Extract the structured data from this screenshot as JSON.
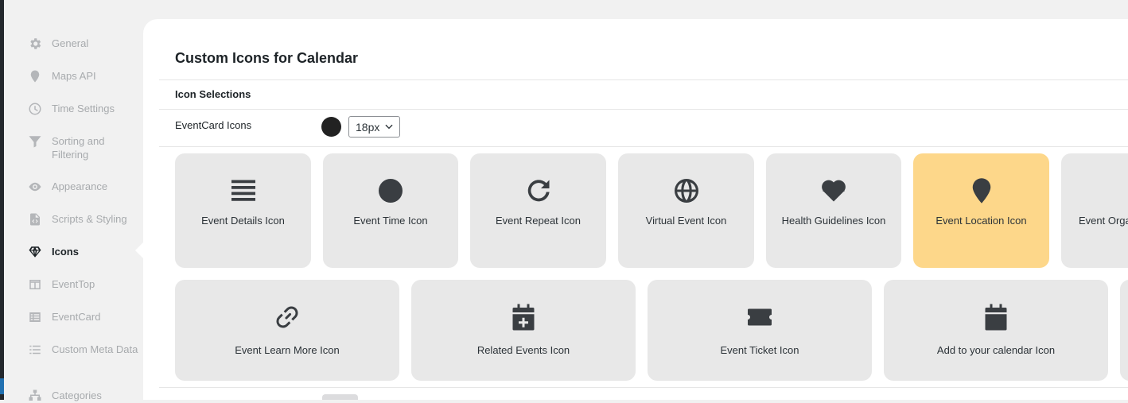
{
  "sidebar": {
    "items": [
      {
        "label": "General",
        "icon": "gear-icon"
      },
      {
        "label": "Maps API",
        "icon": "map-pin-icon"
      },
      {
        "label": "Time Settings",
        "icon": "clock-icon"
      },
      {
        "label": "Sorting and Filtering",
        "icon": "filter-icon"
      },
      {
        "label": "Appearance",
        "icon": "eye-icon"
      },
      {
        "label": "Scripts & Styling",
        "icon": "code-file-icon"
      },
      {
        "label": "Icons",
        "icon": "gem-icon",
        "active": true
      },
      {
        "label": "EventTop",
        "icon": "layout-icon"
      },
      {
        "label": "EventCard",
        "icon": "card-list-icon"
      },
      {
        "label": "Custom Meta Data",
        "icon": "list-icon"
      },
      {
        "label": "Categories",
        "icon": "hierarchy-icon"
      }
    ]
  },
  "panel": {
    "title": "Custom Icons for Calendar",
    "section": "Icon Selections",
    "setting_label": "EventCard Icons",
    "color_value": "#222222",
    "size_value": "18px"
  },
  "colors": {
    "card_bg": "#e8e8e8",
    "card_selected_bg": "#fdd78a",
    "icon_fill": "#3a3e42"
  },
  "icons_row1": [
    {
      "label": "Event Details Icon",
      "icon": "align-justify-icon"
    },
    {
      "label": "Event Time Icon",
      "icon": "clock-icon"
    },
    {
      "label": "Event Repeat Icon",
      "icon": "redo-icon"
    },
    {
      "label": "Virtual Event Icon",
      "icon": "globe-icon"
    },
    {
      "label": "Health Guidelines Icon",
      "icon": "heartbeat-icon"
    },
    {
      "label": "Event Location Icon",
      "icon": "map-pin-icon",
      "selected": true
    },
    {
      "label": "Event Orga",
      "icon": "microphone-icon"
    }
  ],
  "icons_row2": [
    {
      "label": "Event Learn More Icon",
      "icon": "link-icon"
    },
    {
      "label": "Related Events Icon",
      "icon": "calendar-plus-icon"
    },
    {
      "label": "Event Ticket Icon",
      "icon": "ticket-icon"
    },
    {
      "label": "Add to your calendar Icon",
      "icon": "calendar-icon"
    }
  ]
}
